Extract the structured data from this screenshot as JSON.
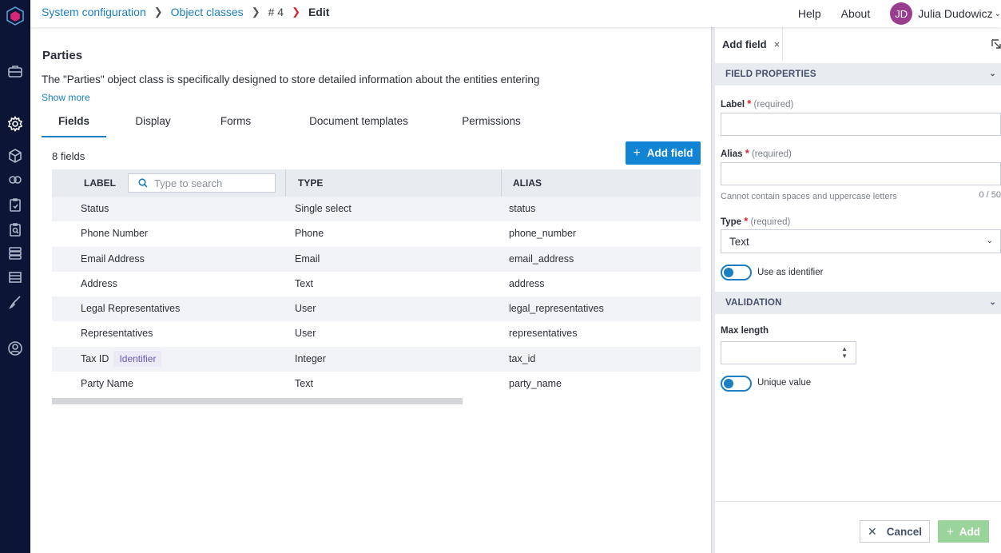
{
  "breadcrumb": {
    "items": [
      "System configuration",
      "Object classes",
      "# 4",
      "Edit"
    ]
  },
  "topbar": {
    "help": "Help",
    "about": "About",
    "user_initials": "JD",
    "user_name": "Julia Dudowicz"
  },
  "object": {
    "title": "Parties",
    "description": "The \"Parties\" object class is specifically designed to store detailed information about the entities entering",
    "show_more": "Show more"
  },
  "tabs": [
    "Fields",
    "Display",
    "Forms",
    "Document templates",
    "Permissions"
  ],
  "fields_count": "8 fields",
  "add_field_button": "Add field",
  "table": {
    "headers": {
      "label": "LABEL",
      "type": "TYPE",
      "alias": "ALIAS"
    },
    "search_placeholder": "Type to search",
    "rows": [
      {
        "label": "Status",
        "type": "Single select",
        "alias": "status"
      },
      {
        "label": "Phone Number",
        "type": "Phone",
        "alias": "phone_number"
      },
      {
        "label": "Email Address",
        "type": "Email",
        "alias": "email_address"
      },
      {
        "label": "Address",
        "type": "Text",
        "alias": "address"
      },
      {
        "label": "Legal Representatives",
        "type": "User",
        "alias": "legal_representatives"
      },
      {
        "label": "Representatives",
        "type": "User",
        "alias": "representatives"
      },
      {
        "label": "Tax ID",
        "badge": "Identifier",
        "type": "Integer",
        "alias": "tax_id"
      },
      {
        "label": "Party Name",
        "type": "Text",
        "alias": "party_name"
      }
    ]
  },
  "panel": {
    "tab_label": "Add field",
    "close": "×",
    "field_properties": "FIELD PROPERTIES",
    "label_label": "Label",
    "label_hint": "(required)",
    "alias_label": "Alias",
    "alias_hint": "(required)",
    "alias_help": "Cannot contain spaces and uppercase letters",
    "alias_count": "0 / 50",
    "type_label": "Type",
    "type_hint": "(required)",
    "type_value": "Text",
    "use_identifier": "Use as identifier",
    "validation": "VALIDATION",
    "max_length": "Max length",
    "unique_value": "Unique value",
    "cancel": "Cancel",
    "add": "Add",
    "required_mark": "*"
  },
  "colors": {
    "rail": "#0c1535",
    "accent": "#1b7fc1",
    "primary_button": "#1284d6",
    "add_disabled": "#9bd49b",
    "required": "#d9232d",
    "badge": "#eceaf7"
  },
  "icons": {
    "rail": [
      "logo-cube-icon",
      "briefcase-icon",
      "gear-icon",
      "cube-icon",
      "links-icon",
      "clipboard-icon",
      "clipboard-search-icon",
      "layers-icon",
      "table-icon",
      "brush-icon",
      "user-circle-icon"
    ]
  }
}
